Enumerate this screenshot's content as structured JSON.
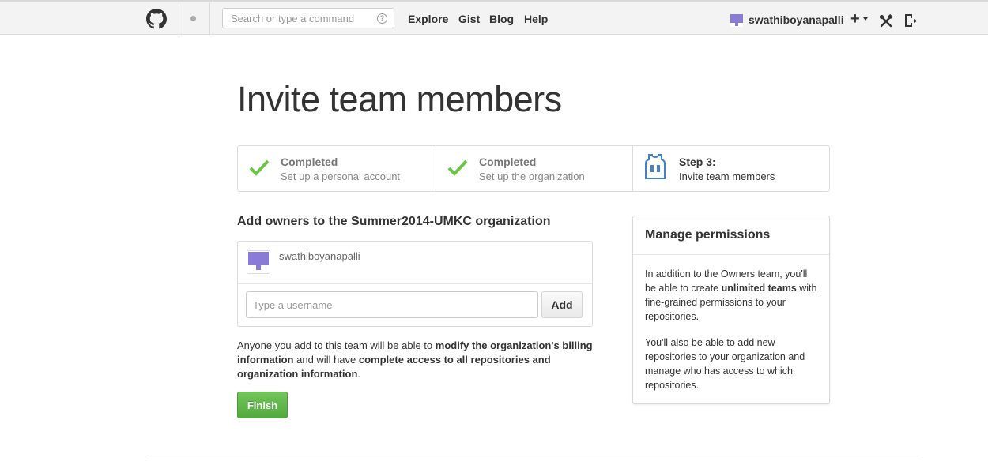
{
  "header": {
    "search_placeholder": "Search or type a command",
    "search_help_glyph": "?",
    "nav": [
      "Explore",
      "Gist",
      "Blog",
      "Help"
    ],
    "username": "swathiboyanapalli",
    "plus_glyph": "+"
  },
  "page": {
    "title": "Invite team members"
  },
  "steps": [
    {
      "status": "Completed",
      "desc": "Set up a personal account"
    },
    {
      "status": "Completed",
      "desc": "Set up the organization"
    },
    {
      "status": "Step 3:",
      "desc": "Invite team members"
    }
  ],
  "owners": {
    "title": "Add owners to the Summer2014-UMKC organization",
    "members": [
      "swathiboyanapalli"
    ],
    "input_placeholder": "Type a username",
    "add_label": "Add"
  },
  "note": {
    "t1": "Anyone you add to this team will be able to ",
    "b1": "modify the organization's billing information",
    "t2": " and will have ",
    "b2": "complete access to all repositories and organization information",
    "t3": "."
  },
  "finish_label": "Finish",
  "permissions": {
    "title": "Manage permissions",
    "p1_pre": "In addition to the Owners team, you'll be able to create ",
    "p1_bold": "unlimited teams",
    "p1_post": " with fine-grained permissions to your repositories.",
    "p2": "You'll also be able to add new repositories to your organization and manage who has access to which repositories."
  },
  "colors": {
    "check_green": "#6cc644",
    "finish_green": "#60b044",
    "jersey_blue": "#4183c4",
    "avatar_purple": "#8a7bd6"
  }
}
